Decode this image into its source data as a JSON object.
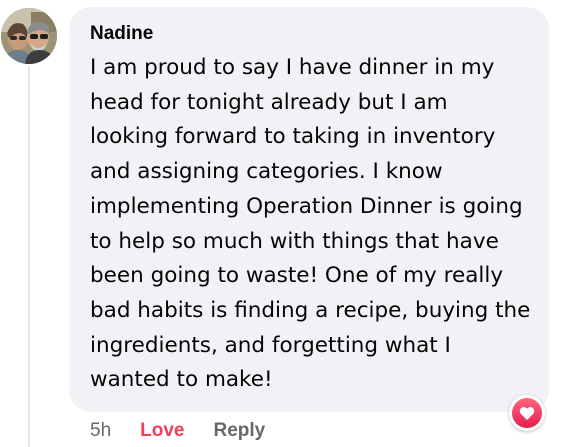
{
  "comment": {
    "author": "Nadine",
    "text": "I am proud to say I have dinner in my head for tonight already but I am looking forward to taking in inventory and assigning categories. I know implementing Operation Dinner is going to help so much with things that have been going to waste! One of my really bad habits is finding a recipe, buying the ingredients, and forgetting what I wanted to make!",
    "avatar_icon": "profile-photo-couple",
    "reaction_icon": "heart-icon",
    "reaction_color": "#f33e58"
  },
  "actions": {
    "timestamp": "5h",
    "love_label": "Love",
    "reply_label": "Reply"
  },
  "colors": {
    "bubble_background": "#f0f2f5",
    "text": "#050505",
    "secondary_text": "#65676b",
    "love": "#f33e58"
  }
}
